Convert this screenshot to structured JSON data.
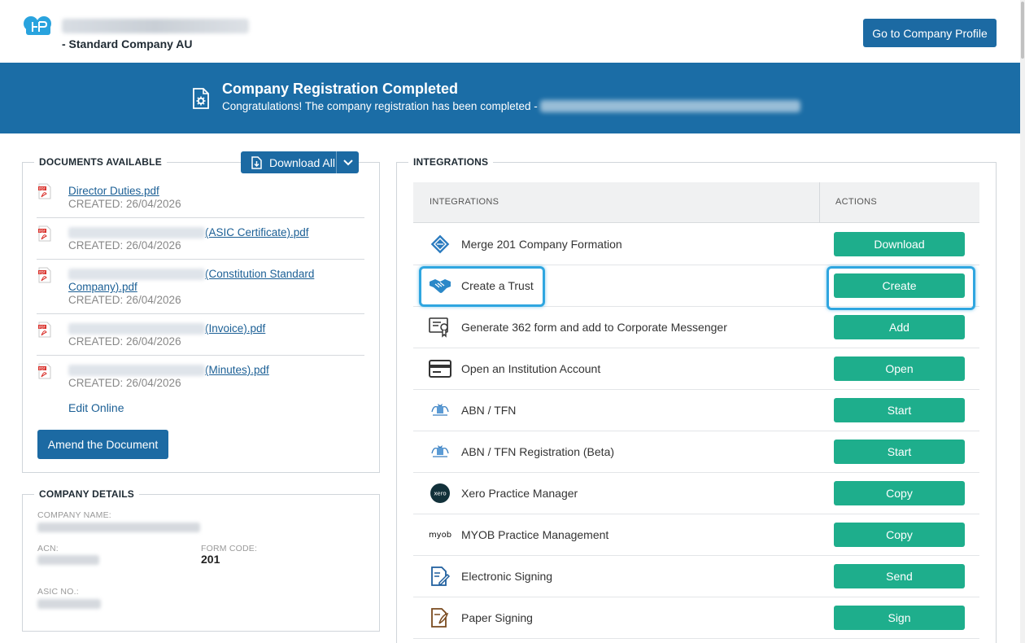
{
  "header": {
    "company_sub": "- Standard Company AU",
    "profile_button": "Go to Company Profile"
  },
  "banner": {
    "title": "Company Registration Completed",
    "text": "Congratulations! The company registration has been completed -"
  },
  "documents": {
    "title": "DOCUMENTS AVAILABLE",
    "download_all": "Download All",
    "items": [
      {
        "name": "Director Duties.pdf",
        "suffix": "",
        "created": "CREATED: 26/04/2026"
      },
      {
        "name": "",
        "suffix": "(ASIC Certificate).pdf",
        "created": "CREATED: 26/04/2026"
      },
      {
        "name": "",
        "suffix": "(Constitution Standard",
        "suffix2": "Company).pdf",
        "created": "CREATED: 26/04/2026"
      },
      {
        "name": "",
        "suffix": "(Invoice).pdf",
        "created": "CREATED: 26/04/2026"
      },
      {
        "name": "",
        "suffix": "(Minutes).pdf",
        "created": "CREATED: 26/04/2026"
      }
    ],
    "edit_online": "Edit Online",
    "amend_button": "Amend the Document"
  },
  "company_details": {
    "title": "COMPANY DETAILS",
    "company_name_label": "COMPANY NAME:",
    "acn_label": "ACN:",
    "form_code_label": "FORM CODE:",
    "form_code_value": "201",
    "asic_label": "ASIC NO.:"
  },
  "integrations": {
    "title": "INTEGRATIONS",
    "col_integrations": "INTEGRATIONS",
    "col_actions": "ACTIONS",
    "rows": [
      {
        "label": "Merge 201 Company Formation",
        "action": "Download",
        "icon": "merge-diamond-icon"
      },
      {
        "label": "Create a Trust",
        "action": "Create",
        "icon": "handshake-icon"
      },
      {
        "label": "Generate 362 form and add to Corporate Messenger",
        "action": "Add",
        "icon": "certificate-icon"
      },
      {
        "label": "Open an Institution Account",
        "action": "Open",
        "icon": "card-icon"
      },
      {
        "label": "ABN / TFN",
        "action": "Start",
        "icon": "coat-of-arms-icon"
      },
      {
        "label": "ABN / TFN Registration (Beta)",
        "action": "Start",
        "icon": "coat-of-arms-icon"
      },
      {
        "label": "Xero Practice Manager",
        "action": "Copy",
        "icon": "xero-icon",
        "icon_text": "xero"
      },
      {
        "label": "MYOB Practice Management",
        "action": "Copy",
        "icon": "myob-icon",
        "icon_text": "myob"
      },
      {
        "label": "Electronic Signing",
        "action": "Send",
        "icon": "e-sign-icon"
      },
      {
        "label": "Paper Signing",
        "action": "Sign",
        "icon": "paper-sign-icon"
      }
    ]
  },
  "colors": {
    "primary": "#1c6aa3",
    "banner": "#1b6da6",
    "action_green": "#1eae8c",
    "highlight": "#2fa6e0"
  }
}
